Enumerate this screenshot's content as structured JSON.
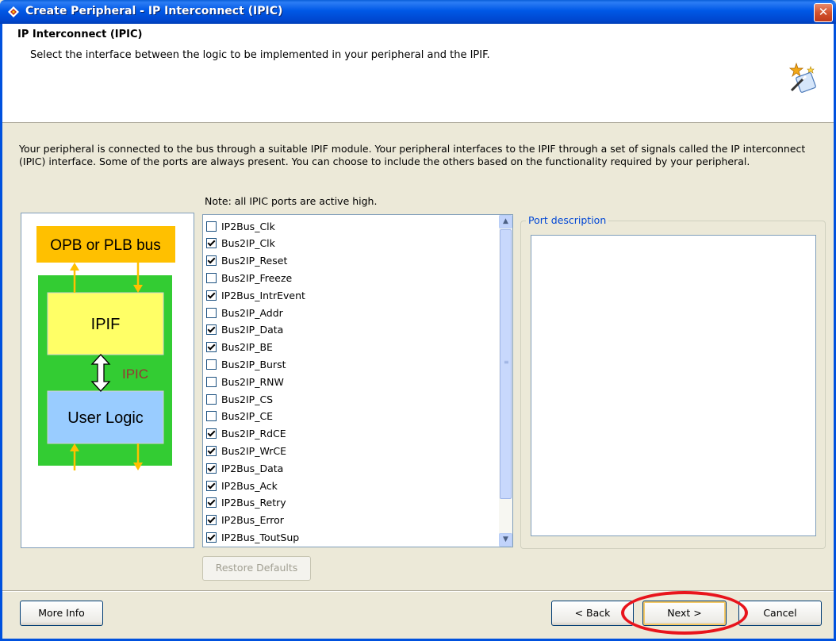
{
  "window": {
    "title": "Create Peripheral - IP Interconnect (IPIC)",
    "close_glyph": "✕"
  },
  "header": {
    "title": "IP Interconnect (IPIC)",
    "subtitle": "Select the interface between the logic to be implemented in your peripheral and the IPIF."
  },
  "intro": "Your peripheral is connected to the bus through a suitable IPIF module. Your peripheral interfaces to the IPIF through a set of signals called the IP interconnect (IPIC) interface. Some of the ports are always present. You can choose to include the others based on the functionality required by your peripheral.",
  "note": "Note: all IPIC ports are active high.",
  "diagram": {
    "bus_label": "OPB or PLB bus",
    "ipif_label": "IPIF",
    "ipic_label": "IPIC",
    "user_logic_label": "User Logic",
    "colors": {
      "bus": "#ffc000",
      "green": "#33cc33",
      "ipif": "#ffff66",
      "user_logic": "#99ccff",
      "arrow": "#ffc000",
      "ipic_text": "#993333"
    }
  },
  "ports": [
    {
      "label": "IP2Bus_Clk",
      "checked": false
    },
    {
      "label": "Bus2IP_Clk",
      "checked": true
    },
    {
      "label": "Bus2IP_Reset",
      "checked": true
    },
    {
      "label": "Bus2IP_Freeze",
      "checked": false
    },
    {
      "label": "IP2Bus_IntrEvent",
      "checked": true
    },
    {
      "label": "Bus2IP_Addr",
      "checked": false
    },
    {
      "label": "Bus2IP_Data",
      "checked": true
    },
    {
      "label": "Bus2IP_BE",
      "checked": true
    },
    {
      "label": "Bus2IP_Burst",
      "checked": false
    },
    {
      "label": "Bus2IP_RNW",
      "checked": false
    },
    {
      "label": "Bus2IP_CS",
      "checked": false
    },
    {
      "label": "Bus2IP_CE",
      "checked": false
    },
    {
      "label": "Bus2IP_RdCE",
      "checked": true
    },
    {
      "label": "Bus2IP_WrCE",
      "checked": true
    },
    {
      "label": "IP2Bus_Data",
      "checked": true
    },
    {
      "label": "IP2Bus_Ack",
      "checked": true
    },
    {
      "label": "IP2Bus_Retry",
      "checked": true
    },
    {
      "label": "IP2Bus_Error",
      "checked": true
    },
    {
      "label": "IP2Bus_ToutSup",
      "checked": true
    }
  ],
  "buttons": {
    "restore_defaults": "Restore Defaults",
    "more_info": "More Info",
    "back": "< Back",
    "next": "Next >",
    "cancel": "Cancel"
  },
  "port_description": {
    "label": "Port description",
    "text": ""
  },
  "highlight_color": "#e8141c"
}
